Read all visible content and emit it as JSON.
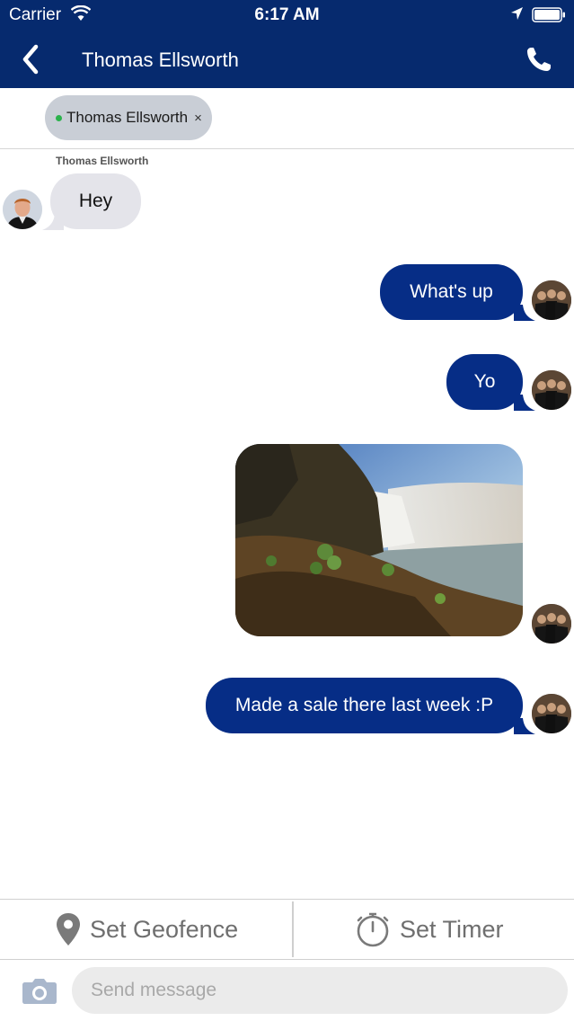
{
  "status_bar": {
    "carrier": "Carrier",
    "time": "6:17 AM"
  },
  "nav": {
    "title": "Thomas Ellsworth",
    "back_icon": "chevron-left-icon",
    "call_icon": "phone-icon"
  },
  "recipients": [
    {
      "name": "Thomas Ellsworth",
      "remove": "×",
      "online": true
    }
  ],
  "messages": [
    {
      "direction": "in",
      "sender": "Thomas Ellsworth",
      "text": "Hey"
    },
    {
      "direction": "out",
      "text": "What's up"
    },
    {
      "direction": "out",
      "text": "Yo"
    },
    {
      "direction": "out",
      "type": "image"
    },
    {
      "direction": "out",
      "text": "Made a sale there last week :P"
    }
  ],
  "actions": {
    "geofence_label": "Set Geofence",
    "timer_label": "Set Timer"
  },
  "composer": {
    "placeholder": "Send message"
  },
  "colors": {
    "navy": "#062a6e",
    "bubble_out": "#062d86",
    "bubble_in": "#e4e4ea",
    "online": "#2bb24c"
  }
}
